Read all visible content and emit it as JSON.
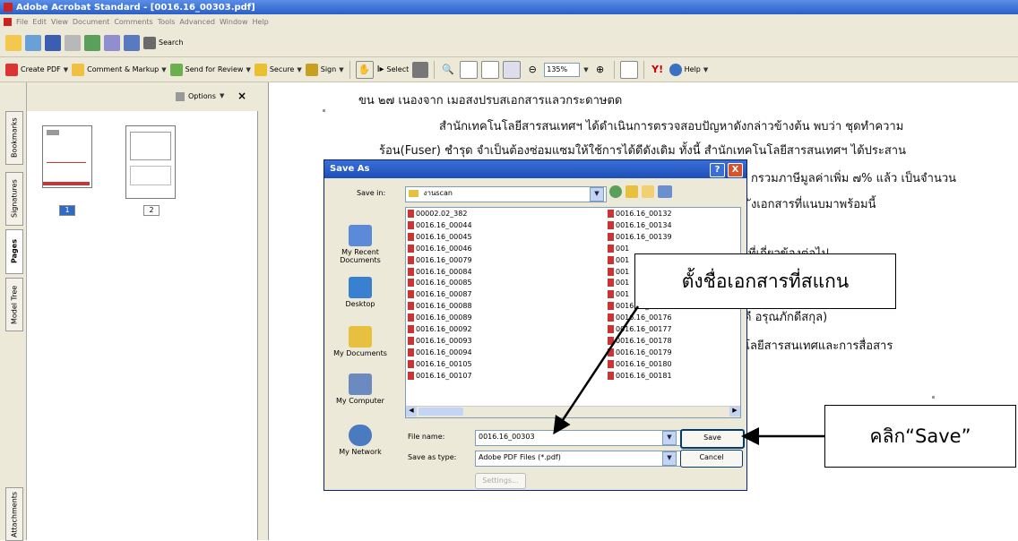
{
  "window": {
    "title": "Adobe Acrobat Standard - [0016.16_00303.pdf]"
  },
  "menu": [
    "File",
    "Edit",
    "View",
    "Document",
    "Comments",
    "Tools",
    "Advanced",
    "Window",
    "Help"
  ],
  "toolbar1": {
    "search_label": "Search"
  },
  "toolbar2": {
    "create_pdf": "Create PDF",
    "comment_markup": "Comment & Markup",
    "send_review": "Send for Review",
    "secure": "Secure",
    "sign": "Sign",
    "select": "Select",
    "zoom": "135%",
    "help": "Help"
  },
  "nav": {
    "options_label": "Options",
    "close": "×",
    "tabs": [
      "Bookmarks",
      "Signatures",
      "Pages",
      "Model Tree",
      "Attachments"
    ],
    "pages": [
      "1",
      "2"
    ]
  },
  "document": {
    "lines": [
      "ขน ๒๗ เนองจาก เมอสงปรบสเอกสารแลวกระดาษตด",
      "สำนักเทคโนโลยีสารสนเทศฯ ได้ดำเนินการตรวจสอบปัญหาดังกล่าวข้างต้น พบว่า ชุดทำความ",
      "ร้อน(Fuser) ชำรุด จำเป็นต้องซ่อมแซมให้ใช้การได้ดีดังเดิม ทั้งนี้ สำนักเทคโนโลยีสารสนเทศฯ ได้ประสาน",
      "กรวมภาษีมูลค่าเพิ่ม ๗% แล้ว เป็นจำนวน",
      "ังเอกสารที่แนบมาพร้อมนี้",
      "ที่เกี่ยวข้องต่อไป",
      "ดี อรุณภักดีสกุล)",
      "โลยีสารสนเทศและการสื่อสาร"
    ]
  },
  "dialog": {
    "title": "Save As",
    "help_btn": "?",
    "close_btn": "X",
    "save_in_label": "Save in:",
    "save_in_value": "งานscan",
    "places": [
      "My Recent Documents",
      "Desktop",
      "My Documents",
      "My Computer",
      "My Network"
    ],
    "files_col1": [
      "00002.02_382",
      "0016.16_00044",
      "0016.16_00045",
      "0016.16_00046",
      "0016.16_00079",
      "0016.16_00084",
      "0016.16_00085",
      "0016.16_00087",
      "0016.16_00088",
      "0016.16_00089",
      "0016.16_00092",
      "0016.16_00093",
      "0016.16_00094",
      "0016.16_00105",
      "0016.16_00107"
    ],
    "files_col2": [
      "0016.16_00132",
      "0016.16_00134",
      "0016.16_00139",
      "001",
      "001",
      "001",
      "001",
      "001",
      "0016.16_00169",
      "0016.16_00176",
      "0016.16_00177",
      "0016.16_00178",
      "0016.16_00179",
      "0016.16_00180",
      "0016.16_00181"
    ],
    "file_name_label": "File name:",
    "file_name_value": "0016.16_00303",
    "save_type_label": "Save as type:",
    "save_type_value": "Adobe PDF Files (*.pdf)",
    "save_btn": "Save",
    "cancel_btn": "Cancel",
    "settings_btn": "Settings..."
  },
  "callouts": {
    "name_doc": "ตั้งชื่อเอกสารที่สแกน",
    "click_save": "คลิก“Save”"
  }
}
